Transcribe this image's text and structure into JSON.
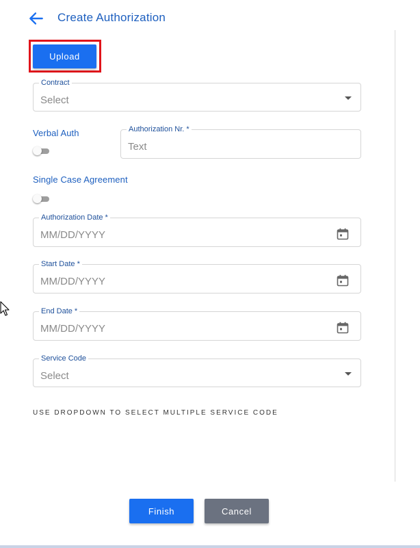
{
  "header": {
    "title": "Create Authorization",
    "back_icon": "arrow-left-icon"
  },
  "colors": {
    "primary": "#1a6ff0",
    "title_blue": "#1d5fbf",
    "highlight_red": "#e0141b",
    "cancel_gray": "#6b7280"
  },
  "toolbar": {
    "upload_label": "Upload"
  },
  "form": {
    "contract": {
      "label": "Contract",
      "value": "Select"
    },
    "verbal_auth": {
      "label": "Verbal Auth",
      "enabled": false
    },
    "authorization_nr": {
      "label": "Authorization Nr. *",
      "placeholder": "Text"
    },
    "single_case_agreement": {
      "label": "Single Case Agreement",
      "enabled": false
    },
    "authorization_date": {
      "label": "Authorization Date *",
      "placeholder": "MM/DD/YYYY"
    },
    "start_date": {
      "label": "Start Date *",
      "placeholder": "MM/DD/YYYY"
    },
    "end_date": {
      "label": "End Date *",
      "placeholder": "MM/DD/YYYY"
    },
    "service_code": {
      "label": "Service Code",
      "value": "Select"
    },
    "helper_text": "USE DROPDOWN TO SELECT MULTIPLE SERVICE CODE"
  },
  "actions": {
    "finish_label": "Finish",
    "cancel_label": "Cancel"
  }
}
